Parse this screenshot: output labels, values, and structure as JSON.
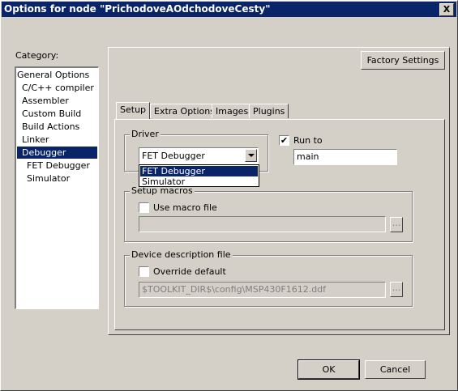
{
  "window": {
    "title": "Options for node \"PrichodoveAOdchodoveCesty\"",
    "close_glyph": "X"
  },
  "category": {
    "label": "Category:",
    "items": [
      {
        "label": "General Options",
        "selected": false
      },
      {
        "label": "C/C++ compiler",
        "selected": false
      },
      {
        "label": "Assembler",
        "selected": false
      },
      {
        "label": "Custom Build",
        "selected": false
      },
      {
        "label": "Build Actions",
        "selected": false
      },
      {
        "label": "Linker",
        "selected": false
      },
      {
        "label": "Debugger",
        "selected": true
      },
      {
        "label": "FET Debugger",
        "selected": false
      },
      {
        "label": "Simulator",
        "selected": false
      }
    ]
  },
  "factory_settings_label": "Factory Settings",
  "tabs": [
    {
      "label": "Setup",
      "active": true
    },
    {
      "label": "Extra Options",
      "active": false
    },
    {
      "label": "Images",
      "active": false
    },
    {
      "label": "Plugins",
      "active": false
    }
  ],
  "driver": {
    "legend": "Driver",
    "selected": "FET Debugger",
    "options": [
      {
        "label": "FET Debugger",
        "highlighted": true
      },
      {
        "label": "Simulator",
        "highlighted": false
      }
    ]
  },
  "run_to": {
    "label": "Run to",
    "checked": true,
    "check_glyph": "✔",
    "value": "main"
  },
  "setup_macros": {
    "legend": "Setup macros",
    "checkbox_label": "Use macro file",
    "checked": false,
    "path": "",
    "browse_label": "..."
  },
  "device_description": {
    "legend": "Device description file",
    "checkbox_label": "Override default",
    "checked": false,
    "path": "$TOOLKIT_DIR$\\config\\MSP430F1612.ddf",
    "browse_label": "..."
  },
  "buttons": {
    "ok": "OK",
    "cancel": "Cancel"
  }
}
